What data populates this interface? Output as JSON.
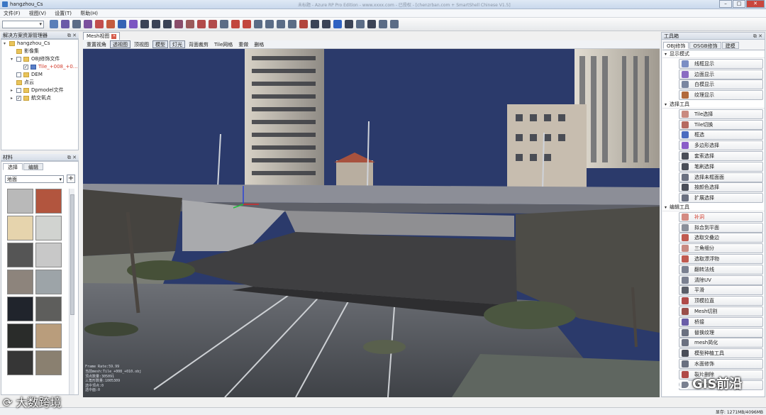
{
  "window": {
    "title": "hangzhou_Cs",
    "center_text": "未标题 - Azure RP Pro Edition - www.xxxx.com - 已授权 - [chenzrban.com + SmartShell Chinese V1.5]"
  },
  "menu": [
    "文件(F)",
    "视图(V)",
    "设置(T)",
    "帮助(H)"
  ],
  "toolbar": {
    "combo_value": "",
    "icons": [
      {
        "name": "window-icon",
        "color": "#5a7fb8"
      },
      {
        "name": "layers-icon",
        "color": "#6b5aa8"
      },
      {
        "name": "split-icon",
        "color": "#5b6c86"
      },
      {
        "name": "building-icon",
        "color": "#7a4f9e"
      },
      {
        "name": "palette-icon",
        "color": "#c24d4d"
      },
      {
        "name": "tile-icon",
        "color": "#c45b3e"
      },
      {
        "name": "search-icon",
        "color": "#3563b4"
      },
      {
        "name": "sparkle-icon",
        "color": "#7c56c2"
      },
      {
        "name": "cursor-icon",
        "color": "#3b4356"
      },
      {
        "name": "arrow-icon",
        "color": "#3b4356"
      },
      {
        "name": "brush-icon",
        "color": "#3b4356"
      },
      {
        "name": "stamp-icon",
        "color": "#8a4d6a"
      },
      {
        "name": "box-icon",
        "color": "#9b5a5a"
      },
      {
        "name": "shape-icon",
        "color": "#b24a4a"
      },
      {
        "name": "rotate-icon",
        "color": "#b24a4a"
      },
      {
        "name": "chain-icon",
        "color": "#5b6c86"
      },
      {
        "name": "gear-icon",
        "color": "#c2463e"
      },
      {
        "name": "grid-icon",
        "color": "#c2463e"
      },
      {
        "name": "link-icon",
        "color": "#5b6c86"
      },
      {
        "name": "eraser-icon",
        "color": "#5b6c86"
      },
      {
        "name": "plate-icon",
        "color": "#5b6c86"
      },
      {
        "name": "film-icon",
        "color": "#5b6c86"
      },
      {
        "name": "save-icon",
        "color": "#b2453d"
      },
      {
        "name": "pie-icon",
        "color": "#3b4356"
      },
      {
        "name": "car-icon",
        "color": "#3b4356"
      },
      {
        "name": "uv-icon",
        "color": "#2f62c2"
      },
      {
        "name": "house-icon",
        "color": "#3b4356"
      },
      {
        "name": "clock-icon",
        "color": "#5b6c86"
      },
      {
        "name": "network-icon",
        "color": "#3b4356"
      },
      {
        "name": "document-icon",
        "color": "#5b6c86"
      },
      {
        "name": "export-icon",
        "color": "#5b6c86"
      }
    ]
  },
  "solution_panel": {
    "title": "解决方案资源管理器",
    "items": [
      {
        "label": "hangzhou_Cs",
        "depth": 0,
        "arrow": "▾",
        "type": "folder",
        "checked": null
      },
      {
        "label": "影像集",
        "depth": 1,
        "arrow": "",
        "type": "folder",
        "checked": null
      },
      {
        "label": "OBJ修饰文件",
        "depth": 1,
        "arrow": "▾",
        "type": "folder",
        "checked": false
      },
      {
        "label": "Tile_+008_+0…",
        "depth": 2,
        "arrow": "",
        "type": "file",
        "checked": true,
        "red": true
      },
      {
        "label": "DEM",
        "depth": 1,
        "arrow": "",
        "type": "folder",
        "checked": false
      },
      {
        "label": "点云",
        "depth": 1,
        "arrow": "",
        "type": "folder",
        "checked": null
      },
      {
        "label": "Dpmodel文件",
        "depth": 1,
        "arrow": "▸",
        "type": "folder",
        "checked": false
      },
      {
        "label": "航交氧点",
        "depth": 1,
        "arrow": "▸",
        "type": "folder",
        "checked": true
      }
    ]
  },
  "material_panel": {
    "title": "材料",
    "tabs": [
      "选择",
      "编辑"
    ],
    "category": "地面",
    "swatches": [
      "#b9b9b9",
      "#b2553e",
      "#e6d4ad",
      "#d1d3d0",
      "#555555",
      "#c8c8c8",
      "#8d847c",
      "#9da4a8",
      "#20242c",
      "#5e5e5c",
      "#2a2c2a",
      "#b99d7c",
      "#363636",
      "#8a8070"
    ]
  },
  "view": {
    "tab": "Mesh视图",
    "buttons": [
      {
        "label": "重置视角",
        "on": false
      },
      {
        "label": "透视图",
        "on": true
      },
      {
        "label": "顶视图",
        "on": false
      },
      {
        "label": "模型",
        "on": true
      },
      {
        "label": "灯光",
        "on": true
      },
      {
        "label": "背面裁剪",
        "on": false
      },
      {
        "label": "Tile网格",
        "on": false
      },
      {
        "label": "重做",
        "on": false
      },
      {
        "label": "删格",
        "on": false
      }
    ],
    "overlay": [
      "Frame Rate:59.99",
      "当前mesh:Tile_+008_+010.obj",
      "顶点数量:305091",
      "三角形数量:1005309",
      "选中顶点:0",
      "选中面:0"
    ]
  },
  "toolbox": {
    "title": "工具箱",
    "tabs": [
      "OBJ修饰",
      "OSGB修饰",
      "建模"
    ],
    "sections": [
      {
        "title": "显示模式",
        "tools": [
          {
            "label": "线框显示",
            "icon": "wireframe-icon",
            "color": "#7b8ec4",
            "red": false
          },
          {
            "label": "边面显示",
            "icon": "edge-face-icon",
            "color": "#8a6cc2",
            "red": false
          },
          {
            "label": "白模显示",
            "icon": "white-model-icon",
            "color": "#7a86a0",
            "red": false
          },
          {
            "label": "纹理显示",
            "icon": "texture-icon",
            "color": "#b26a3c",
            "red": false
          }
        ]
      },
      {
        "title": "选择工具",
        "tools": [
          {
            "label": "Tile选择",
            "icon": "tile-select-icon",
            "color": "#c98a80",
            "red": false
          },
          {
            "label": "Tile切换",
            "icon": "tile-switch-icon",
            "color": "#b56a60",
            "red": false
          },
          {
            "label": "框选",
            "icon": "box-select-icon",
            "color": "#4a6cc0",
            "red": false
          },
          {
            "label": "多边形选择",
            "icon": "polygon-select-icon",
            "color": "#8a5cc8",
            "red": false
          },
          {
            "label": "套索选择",
            "icon": "lasso-icon",
            "color": "#4a4e58",
            "red": false
          },
          {
            "label": "笔刷选择",
            "icon": "brush-select-icon",
            "color": "#4a4e58",
            "red": false
          },
          {
            "label": "选择未框面面",
            "icon": "unselected-icon",
            "color": "#6a7080",
            "red": false
          },
          {
            "label": "按颜色选择",
            "icon": "color-select-icon",
            "color": "#4a4e58",
            "red": false
          },
          {
            "label": "扩展选择",
            "icon": "expand-select-icon",
            "color": "#6a7080",
            "red": false
          }
        ]
      },
      {
        "title": "编辑工具",
        "tools": [
          {
            "label": "补洞",
            "icon": "fill-hole-icon",
            "color": "#d48a82",
            "red": true
          },
          {
            "label": "拟合到平面",
            "icon": "fit-plane-icon",
            "color": "#8a8f9a",
            "red": false
          },
          {
            "label": "选取交叠边",
            "icon": "overlap-edge-icon",
            "color": "#c05a50",
            "red": false
          },
          {
            "label": "三角细分",
            "icon": "subdivide-icon",
            "color": "#c88a82",
            "red": false
          },
          {
            "label": "选取漂浮物",
            "icon": "float-select-icon",
            "color": "#c05a50",
            "red": false
          },
          {
            "label": "翻转法线",
            "icon": "flip-normal-icon",
            "color": "#7a8090",
            "red": false
          },
          {
            "label": "清除UV",
            "icon": "clear-uv-icon",
            "color": "#7a8090",
            "red": false
          },
          {
            "label": "平滑",
            "icon": "smooth-icon",
            "color": "#5a5e68",
            "red": false
          },
          {
            "label": "顶模拉直",
            "icon": "straighten-icon",
            "color": "#b04a48",
            "red": false
          },
          {
            "label": "Mesh切割",
            "icon": "mesh-cut-icon",
            "color": "#9a4e4a",
            "red": false
          },
          {
            "label": "桥接",
            "icon": "bridge-icon",
            "color": "#6a5ea8",
            "red": false
          },
          {
            "label": "替换纹理",
            "icon": "replace-texture-icon",
            "color": "#6a7080",
            "red": false
          },
          {
            "label": "mesh简化",
            "icon": "simplify-icon",
            "color": "#6a7080",
            "red": false
          },
          {
            "label": "模型种植工具",
            "icon": "plant-icon",
            "color": "#4a4e58",
            "red": false
          },
          {
            "label": "水面修饰",
            "icon": "water-icon",
            "color": "#6a7080",
            "red": false
          },
          {
            "label": "裂片删除",
            "icon": "delete-icon",
            "color": "#b04a48",
            "red": false
          },
          {
            "label": "超分Tile贴图",
            "icon": "super-res-icon",
            "color": "#7a8090",
            "red": false
          }
        ]
      }
    ]
  },
  "status": {
    "memory": "显存: 1271MB/4096MB"
  },
  "watermarks": {
    "bottom_left": "大数跨境",
    "bottom_right": "GIS前沿"
  },
  "colors": {
    "sky": "#2b3a6b",
    "accent_red": "#d23a2a",
    "ui_border": "#b9c0ca"
  }
}
